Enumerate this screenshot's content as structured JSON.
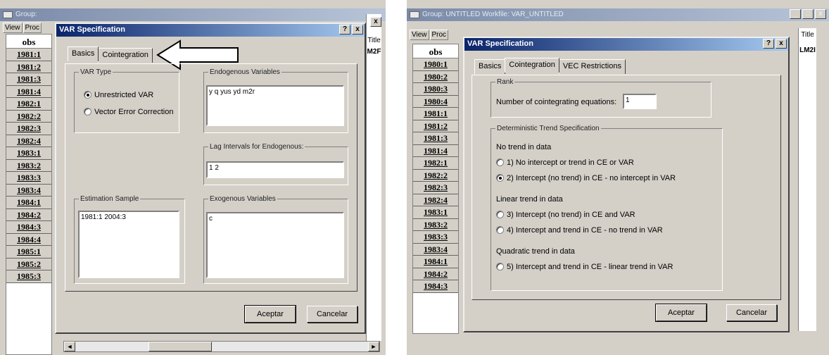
{
  "left": {
    "bg_title": "Group:",
    "menu": [
      "View",
      "Proc"
    ],
    "obs_header": "obs",
    "obs_rows": [
      "1981:1",
      "1981:2",
      "1981:3",
      "1981:4",
      "1982:1",
      "1982:2",
      "1982:3",
      "1982:4",
      "1983:1",
      "1983:2",
      "1983:3",
      "1983:4",
      "1984:1",
      "1984:2",
      "1984:3",
      "1984:4",
      "1985:1",
      "1985:2",
      "1985:3"
    ],
    "right_col_header": "Title",
    "right_col_sub": "M2F",
    "dialog": {
      "title": "VAR Specification",
      "help": "?",
      "close": "x",
      "tabs": [
        "Basics",
        "Cointegration"
      ],
      "var_type_legend": "VAR Type",
      "var_type_options": [
        "Unrestricted VAR",
        "Vector Error Correction"
      ],
      "endogenous_legend": "Endogenous Variables",
      "endogenous_value": "y q yus yd m2r",
      "lag_legend": "Lag Intervals for Endogenous:",
      "lag_value": "1 2",
      "sample_legend": "Estimation Sample",
      "sample_value": "1981:1 2004:3",
      "exogenous_legend": "Exogenous Variables",
      "exogenous_value": "c",
      "ok_label": "Aceptar",
      "cancel_label": "Cancelar"
    }
  },
  "right": {
    "bg_title": "Group: UNTITLED   Workfile: VAR_UNTITLED",
    "window_buttons": [
      "_",
      "□",
      "x"
    ],
    "menu": [
      "View",
      "Proc"
    ],
    "obs_header": "obs",
    "obs_rows": [
      "1980:1",
      "1980:2",
      "1980:3",
      "1980:4",
      "1981:1",
      "1981:2",
      "1981:3",
      "1981:4",
      "1982:1",
      "1982:2",
      "1982:3",
      "1982:4",
      "1983:1",
      "1983:2",
      "1983:3",
      "1983:4",
      "1984:1",
      "1984:2",
      "1984:3"
    ],
    "right_col_header": "Title",
    "right_col_sub": "LM2I",
    "dialog": {
      "title": "VAR Specification",
      "help": "?",
      "close": "x",
      "tabs": [
        "Basics",
        "Cointegration",
        "VEC Restrictions"
      ],
      "rank_legend": "Rank",
      "rank_label": "Number of cointegrating equations:",
      "rank_value": "1",
      "trend_legend": "Deterministic Trend Specification",
      "group1": "No trend in data",
      "opt1": "1)  No intercept or trend in CE or VAR",
      "opt2": "2)  Intercept (no trend) in CE - no intercept in VAR",
      "group2": "Linear trend in data",
      "opt3": "3)  Intercept (no trend) in CE and VAR",
      "opt4": "4)  Intercept and trend in CE - no trend in VAR",
      "group3": "Quadratic trend in data",
      "opt5": "5)  Intercept and trend in CE - linear trend in VAR",
      "ok_label": "Aceptar",
      "cancel_label": "Cancelar"
    }
  }
}
